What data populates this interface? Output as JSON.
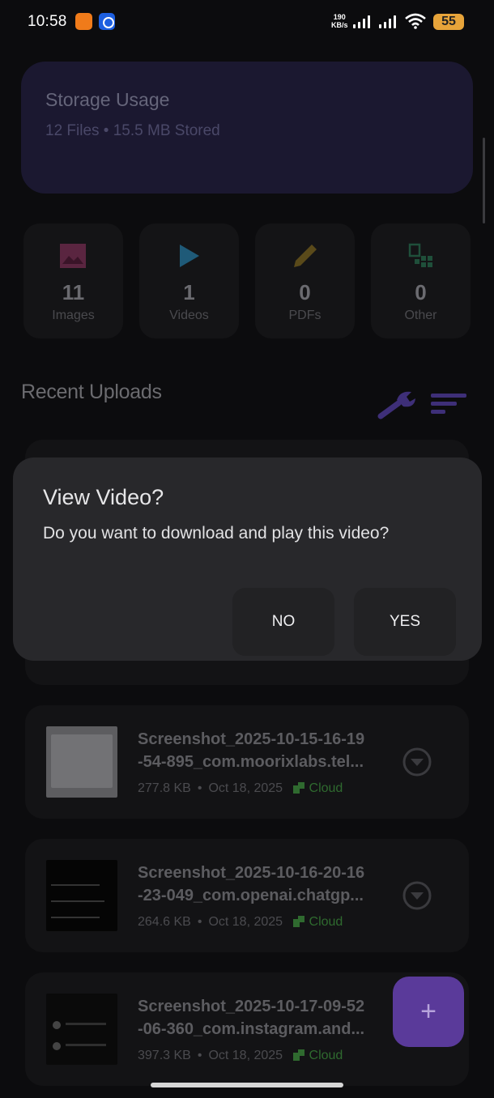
{
  "status_bar": {
    "time": "10:58",
    "app_badge_1": "BIG SALE TEMU",
    "net_speed_value": "190",
    "net_speed_unit": "KB/s",
    "battery": "55"
  },
  "storage": {
    "title": "Storage Usage",
    "summary": "12 Files • 15.5 MB Stored"
  },
  "categories": [
    {
      "count": "11",
      "label": "Images",
      "icon": "image-icon",
      "color": "#5a2540"
    },
    {
      "count": "1",
      "label": "Videos",
      "icon": "play-icon",
      "color": "#1f5a78"
    },
    {
      "count": "0",
      "label": "PDFs",
      "icon": "pencil-icon",
      "color": "#5a4a1a"
    },
    {
      "count": "0",
      "label": "Other",
      "icon": "apps-icon",
      "color": "#1f4f3a"
    }
  ],
  "recent": {
    "title": "Recent Uploads"
  },
  "files": [
    {
      "name_line1": "Screenshot_2025-10-15-16-19",
      "name_line2": "-54-895_com.moorixlabs.tel...",
      "size": "277.8 KB",
      "date": "Oct 18, 2025",
      "location": "Cloud"
    },
    {
      "name_line1": "Screenshot_2025-10-16-20-16",
      "name_line2": "-23-049_com.openai.chatgp...",
      "size": "264.6 KB",
      "date": "Oct 18, 2025",
      "location": "Cloud"
    },
    {
      "name_line1": "Screenshot_2025-10-17-09-52",
      "name_line2": "-06-360_com.instagram.and...",
      "size": "397.3 KB",
      "date": "Oct 18, 2025",
      "location": "Cloud"
    }
  ],
  "meta_separator": "•",
  "fab": {
    "label": "+"
  },
  "dialog": {
    "title": "View Video?",
    "message": "Do you want to download and play this video?",
    "no_label": "NO",
    "yes_label": "YES"
  },
  "colors": {
    "accent": "#5a3a9a",
    "dialog_bg": "#28282b",
    "cloud_green": "#2f6a2f"
  }
}
